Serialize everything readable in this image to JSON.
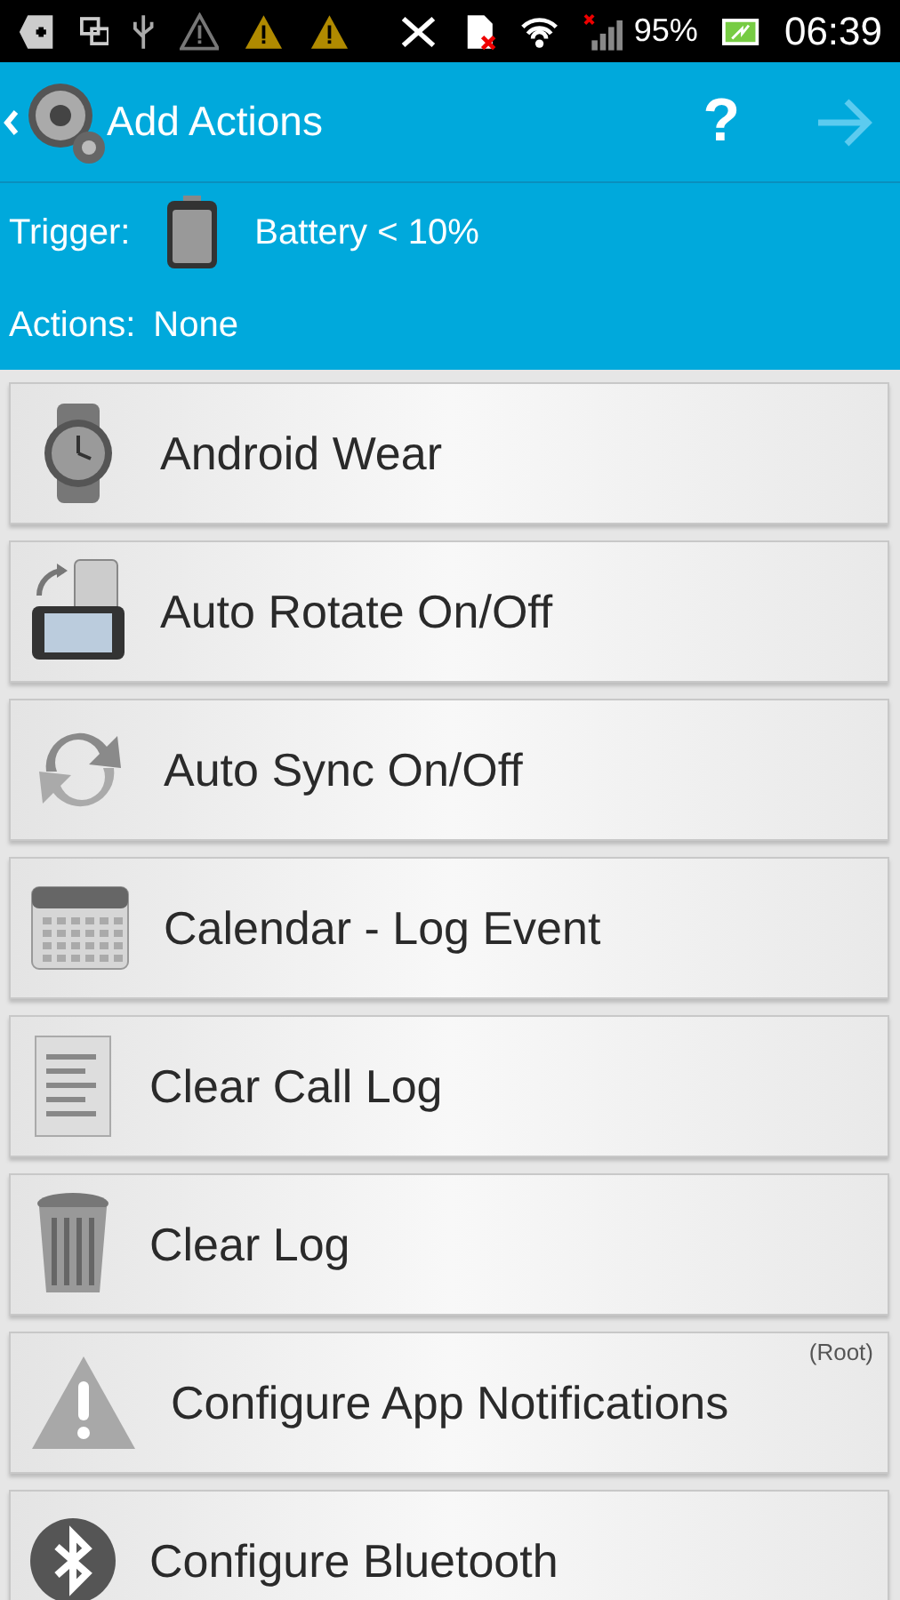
{
  "status_bar": {
    "battery": "95%",
    "time": "06:39"
  },
  "app_bar": {
    "title": "Add Actions",
    "help": "?"
  },
  "trigger": {
    "label": "Trigger:",
    "value": "Battery < 10%"
  },
  "actions": {
    "label": "Actions:",
    "value": "None"
  },
  "items": [
    {
      "kind": "watch",
      "label": "Android Wear"
    },
    {
      "kind": "rotate",
      "label": "Auto Rotate On/Off"
    },
    {
      "kind": "sync",
      "label": "Auto Sync On/Off"
    },
    {
      "kind": "calendar",
      "label": "Calendar - Log Event"
    },
    {
      "kind": "document",
      "label": "Clear Call Log"
    },
    {
      "kind": "trash",
      "label": "Clear Log"
    },
    {
      "kind": "warning",
      "label": "Configure App Notifications",
      "badge": "(Root)"
    },
    {
      "kind": "bluetooth",
      "label": "Configure Bluetooth"
    }
  ]
}
